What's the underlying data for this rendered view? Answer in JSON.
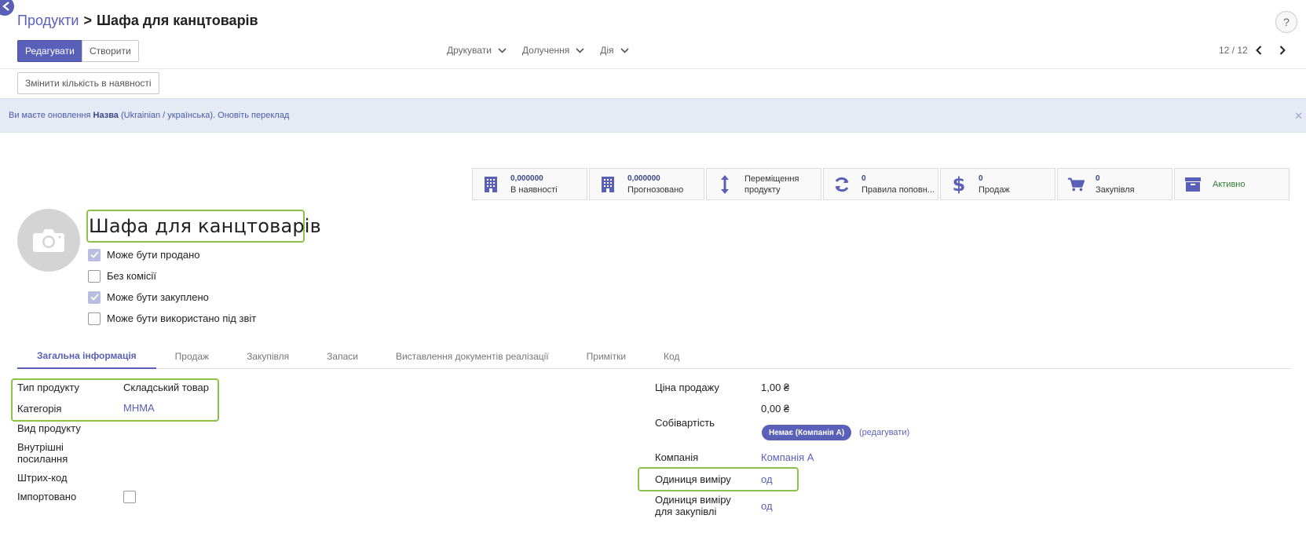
{
  "breadcrumb": {
    "parent": "Продукти",
    "separator": ">",
    "current": "Шафа для канцтоварів"
  },
  "help": {
    "label": "?"
  },
  "toolbar": {
    "edit_label": "Редагувати",
    "create_label": "Створити",
    "dropdowns": [
      "Друкувати",
      "Долучення",
      "Дія"
    ],
    "pager": "12 / 12"
  },
  "status_bar": {
    "update_qty_label": "Змінити кількість в наявності"
  },
  "alert": {
    "prefix": "Ви маєте оновлення",
    "field": "Назва",
    "lang": "(Ukrainian / українська).",
    "action": "Оновіть переклад"
  },
  "stats": [
    {
      "icon": "building-icon",
      "value": "0,000000",
      "label": "В наявності"
    },
    {
      "icon": "building-icon",
      "value": "0,000000",
      "label": "Прогнозовано"
    },
    {
      "icon": "vertical-arrows-icon",
      "value": "Переміщення",
      "label": "продукту"
    },
    {
      "icon": "refresh-icon",
      "value": "0",
      "label": "Правила поповн..."
    },
    {
      "icon": "dollar-icon",
      "value": "0",
      "label": "Продаж"
    },
    {
      "icon": "cart-icon",
      "value": "0",
      "label": "Закупівля"
    },
    {
      "icon": "archive-icon",
      "value": "",
      "label": "Активно"
    }
  ],
  "product": {
    "title": "Шафа для канцтоварів",
    "checkboxes": [
      {
        "label": "Може бути продано",
        "checked": true
      },
      {
        "label": "Без комісії",
        "checked": false
      },
      {
        "label": "Може бути закуплено",
        "checked": true
      },
      {
        "label": "Може бути використано під звіт",
        "checked": false
      }
    ]
  },
  "tabs": [
    "Загальна інформація",
    "Продаж",
    "Закупівля",
    "Запаси",
    "Виставлення документів реалізації",
    "Примітки",
    "Код"
  ],
  "left_fields": {
    "type_label": "Тип продукту",
    "type_value": "Складський товар",
    "category_label": "Категорія",
    "category_value": "МНМА",
    "kind_label": "Вид продукту",
    "internal_ref_label": "Внутрішні посилання",
    "barcode_label": "Штрих-код",
    "imported_label": "Імпортовано"
  },
  "right_fields": {
    "sale_price_label": "Ціна продажу",
    "sale_price_value": "1,00 ₴",
    "cost_label": "Собівартість",
    "cost_value": "0,00 ₴",
    "cost_badge": "Немає (Компанія А)",
    "cost_edit": "(редагувати)",
    "company_label": "Компанія",
    "company_value": "Компанія А",
    "uom_label": "Одиниця виміру",
    "uom_value": "од",
    "uom_po_label": "Одиниця виміру для закупівлі",
    "uom_po_value": "од"
  },
  "colors": {
    "accent": "#5a5fb8",
    "highlight": "#8bc34a",
    "alert_bg": "#e5eaf5",
    "active_green": "#2e7d32"
  }
}
